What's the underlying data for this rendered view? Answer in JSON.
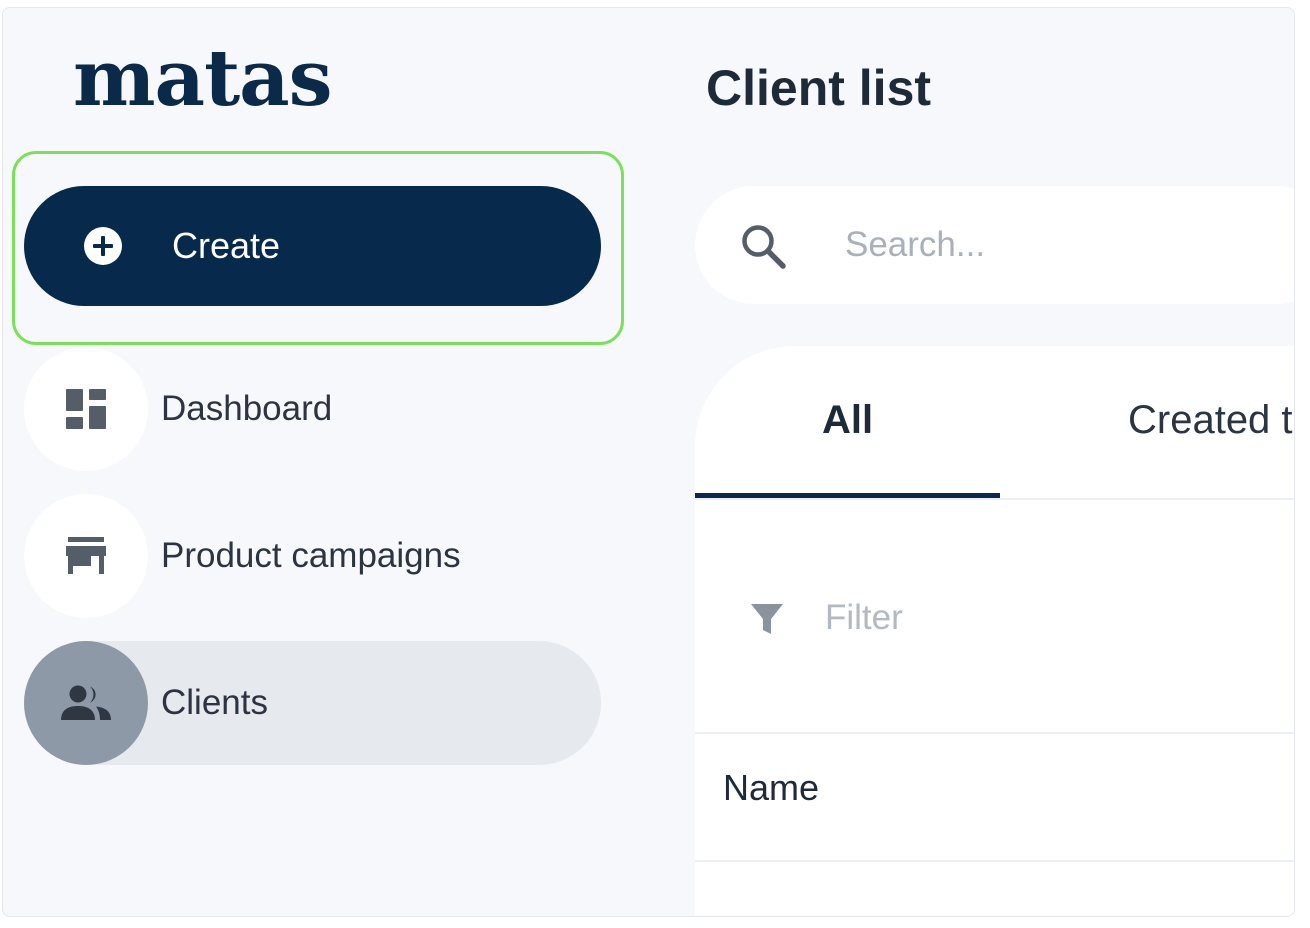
{
  "app": {
    "brand": "matas"
  },
  "sidebar": {
    "create_label": "Create",
    "items": [
      {
        "label": "Dashboard",
        "icon": "dashboard-icon",
        "active": false
      },
      {
        "label": "Product campaigns",
        "icon": "store-icon",
        "active": false
      },
      {
        "label": "Clients",
        "icon": "people-icon",
        "active": true
      }
    ]
  },
  "main": {
    "title": "Client list",
    "search": {
      "placeholder": "Search...",
      "value": ""
    },
    "tabs": [
      {
        "label": "All",
        "selected": true
      },
      {
        "label": "Created t",
        "selected": false
      }
    ],
    "filter_label": "Filter",
    "table": {
      "columns": [
        "Name"
      ]
    }
  },
  "colors": {
    "brand_navy": "#07294b",
    "highlight": "#7be05a",
    "active_nav_bg": "#e6e9ee",
    "active_icon_bg": "#8e99a7"
  }
}
